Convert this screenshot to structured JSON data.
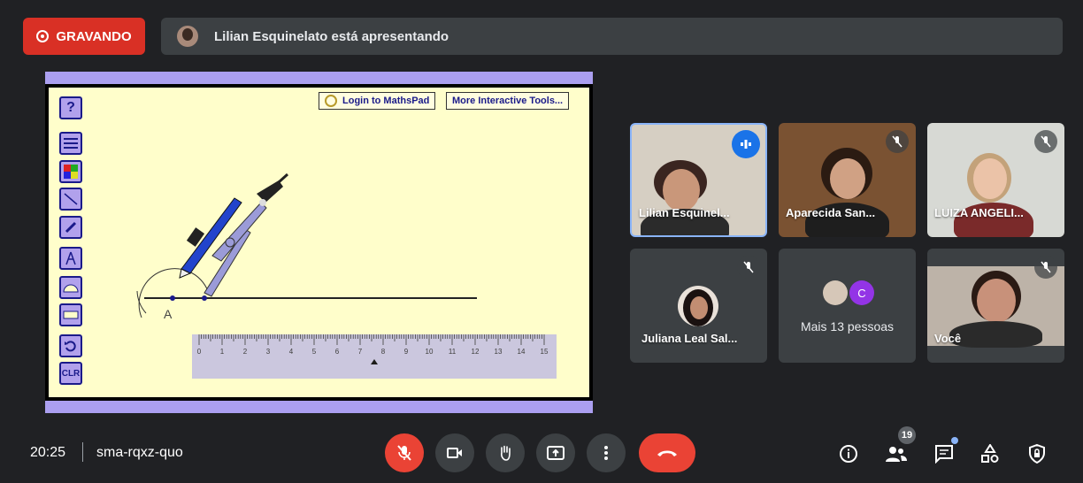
{
  "recording": {
    "label": "GRAVANDO"
  },
  "banner": {
    "text": "Lilian Esquinelato está apresentando"
  },
  "presentation": {
    "buttons": {
      "login": "Login to MathsPad",
      "more_tools": "More Interactive Tools..."
    },
    "tools": {
      "help": "?",
      "clear": "CLR"
    },
    "point_label": "A",
    "ruler_ticks": [
      "0",
      "1",
      "2",
      "3",
      "4",
      "5",
      "6",
      "7",
      "8",
      "9",
      "10",
      "11",
      "12",
      "13",
      "14",
      "15"
    ]
  },
  "participants": [
    {
      "name": "Lilian Esquinel...",
      "speaking": true
    },
    {
      "name": "Aparecida San...",
      "muted": true
    },
    {
      "name": "LUIZA ANGELI...",
      "muted": true
    },
    {
      "name": "Juliana Leal Sal...",
      "muted": true
    },
    {
      "name": "Mais 13 pessoas",
      "avatar_letter": "C"
    },
    {
      "name": "Você",
      "muted": true
    }
  ],
  "bottom_bar": {
    "time": "20:25",
    "meeting_code": "sma-rqxz-quo",
    "people_count": "19"
  },
  "colors": {
    "record": "#d93025",
    "end_call": "#ea4335",
    "speaking_border": "#8ab4f8",
    "canvas": "#fffecb"
  }
}
